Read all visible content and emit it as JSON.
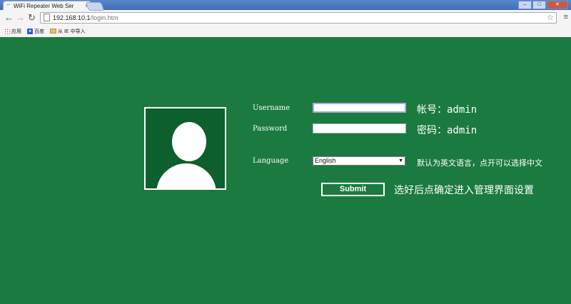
{
  "browser": {
    "tab_title": "WiFi Repeater Web Ser",
    "tab_close": "×",
    "url_host": "192.168.10.1",
    "url_path": "/login.htm",
    "window_buttons": {
      "minimize": "–",
      "maximize": "□",
      "close": "✕"
    },
    "bookmarks": [
      {
        "label": "应用"
      },
      {
        "label": "百度"
      },
      {
        "label": "从 IE 中导入"
      }
    ]
  },
  "login": {
    "username_label": "Username",
    "password_label": "Password",
    "language_label": "Language",
    "username_value": "",
    "password_value": "",
    "language_selected": "English",
    "submit_label": "Submit"
  },
  "notes": {
    "username_hint": "帐号：admin",
    "password_hint": "密码：admin",
    "language_hint": "默认为英文语言，点开可以选择中文",
    "submit_hint": "选好后点确定进入管理界面设置"
  },
  "colors": {
    "background": "#1b7a3f",
    "avatar_box": "#0d5f2e"
  }
}
